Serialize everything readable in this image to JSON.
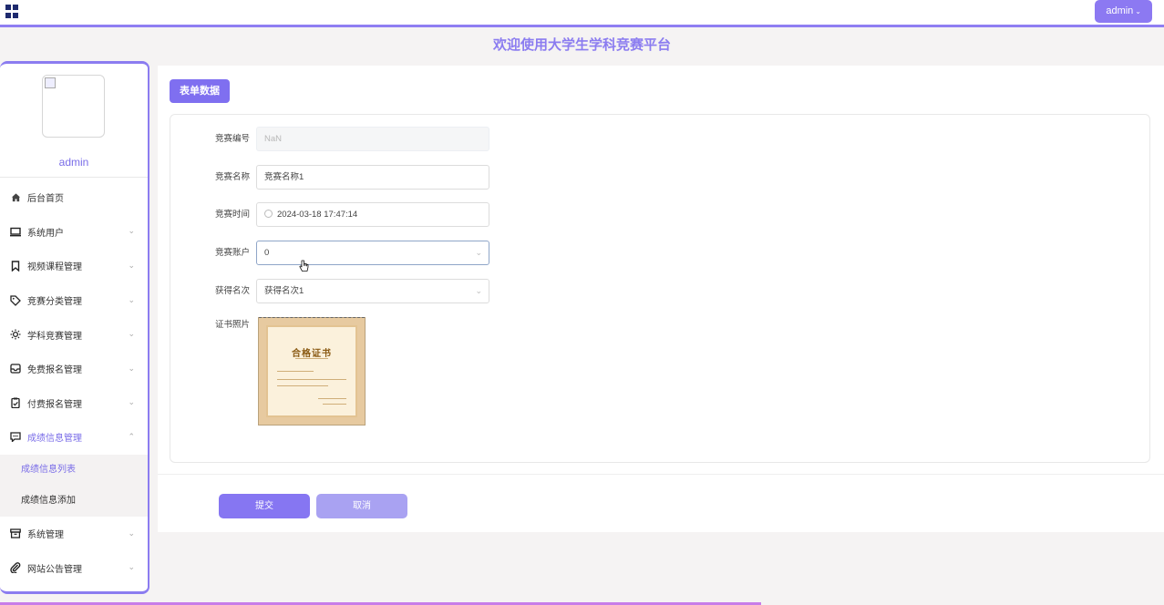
{
  "header": {
    "user_label": "admin",
    "site_title": "欢迎使用大学生学科竞赛平台"
  },
  "sidebar": {
    "username": "admin",
    "items": [
      {
        "label": "后台首页",
        "icon": "home-icon",
        "arrow": ""
      },
      {
        "label": "系统用户",
        "icon": "monitor-icon",
        "arrow": "⌄"
      },
      {
        "label": "视频课程管理",
        "icon": "bookmark-icon",
        "arrow": "⌄"
      },
      {
        "label": "竞赛分类管理",
        "icon": "tag-icon",
        "arrow": "⌄"
      },
      {
        "label": "学科竞赛管理",
        "icon": "sun-icon",
        "arrow": "⌄"
      },
      {
        "label": "免费报名管理",
        "icon": "inbox-icon",
        "arrow": "⌄"
      },
      {
        "label": "付费报名管理",
        "icon": "clipboard-icon",
        "arrow": "⌄"
      },
      {
        "label": "成绩信息管理",
        "icon": "message-icon",
        "arrow": "⌃"
      }
    ],
    "sub_items": [
      {
        "label": "成绩信息列表"
      },
      {
        "label": "成绩信息添加"
      }
    ],
    "items_after": [
      {
        "label": "系统管理",
        "icon": "archive-icon",
        "arrow": "⌄"
      },
      {
        "label": "网站公告管理",
        "icon": "paperclip-icon",
        "arrow": "⌄"
      }
    ]
  },
  "form": {
    "tag": "表单数据",
    "fields": {
      "id": {
        "label": "竞赛编号",
        "value": "NaN"
      },
      "name": {
        "label": "竞赛名称",
        "value": "竞赛名称1"
      },
      "time": {
        "label": "竞赛时间",
        "value": "2024-03-18 17:47:14"
      },
      "account": {
        "label": "竞赛账户",
        "value": "0"
      },
      "rank": {
        "label": "获得名次",
        "value": "获得名次1"
      },
      "photo": {
        "label": "证书照片"
      }
    },
    "certificate_title": "合格证书",
    "submit_label": "提交",
    "cancel_label": "取消"
  }
}
